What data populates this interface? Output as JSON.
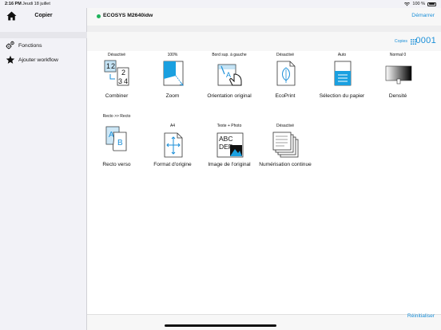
{
  "status": {
    "time": "2:16 PM",
    "date": "Jeudi 18 juillet",
    "battery": "100 %"
  },
  "sidebar": {
    "title": "Copier",
    "items": [
      {
        "label": "Fonctions",
        "icon": "gear-group-icon"
      },
      {
        "label": "Ajouter workflow",
        "icon": "star-icon"
      }
    ]
  },
  "nav": {
    "device": "ECOSYS M2640idw",
    "start": "Démarrer",
    "status_color": "#1fb35b"
  },
  "copies": {
    "label": "Copies",
    "value": "0001"
  },
  "functions": [
    {
      "value": "Désactivé",
      "name": "Combiner",
      "icon": "combine-icon"
    },
    {
      "value": "100%",
      "name": "Zoom",
      "icon": "zoom-icon"
    },
    {
      "value": "Bord sup. à gauche",
      "name": "Orientation original",
      "icon": "orientation-icon"
    },
    {
      "value": "Désactivé",
      "name": "EcoPrint",
      "icon": "ecoprint-icon"
    },
    {
      "value": "Auto",
      "name": "Sélection du papier",
      "icon": "paper-tray-icon"
    },
    {
      "value": "Normal 0",
      "name": "Densité",
      "icon": "density-icon"
    },
    {
      "value": "Recto >> Recto",
      "name": "Recto verso",
      "icon": "duplex-icon"
    },
    {
      "value": "A4",
      "name": "Format d'origine",
      "icon": "original-size-icon"
    },
    {
      "value": "Texte + Photo",
      "name": "Image de l'original",
      "icon": "original-image-icon"
    },
    {
      "value": "Désactivé",
      "name": "Numérisation continue",
      "icon": "continuous-scan-icon"
    }
  ],
  "reset": "Réinitialiser",
  "accent": "#1a8fd8"
}
